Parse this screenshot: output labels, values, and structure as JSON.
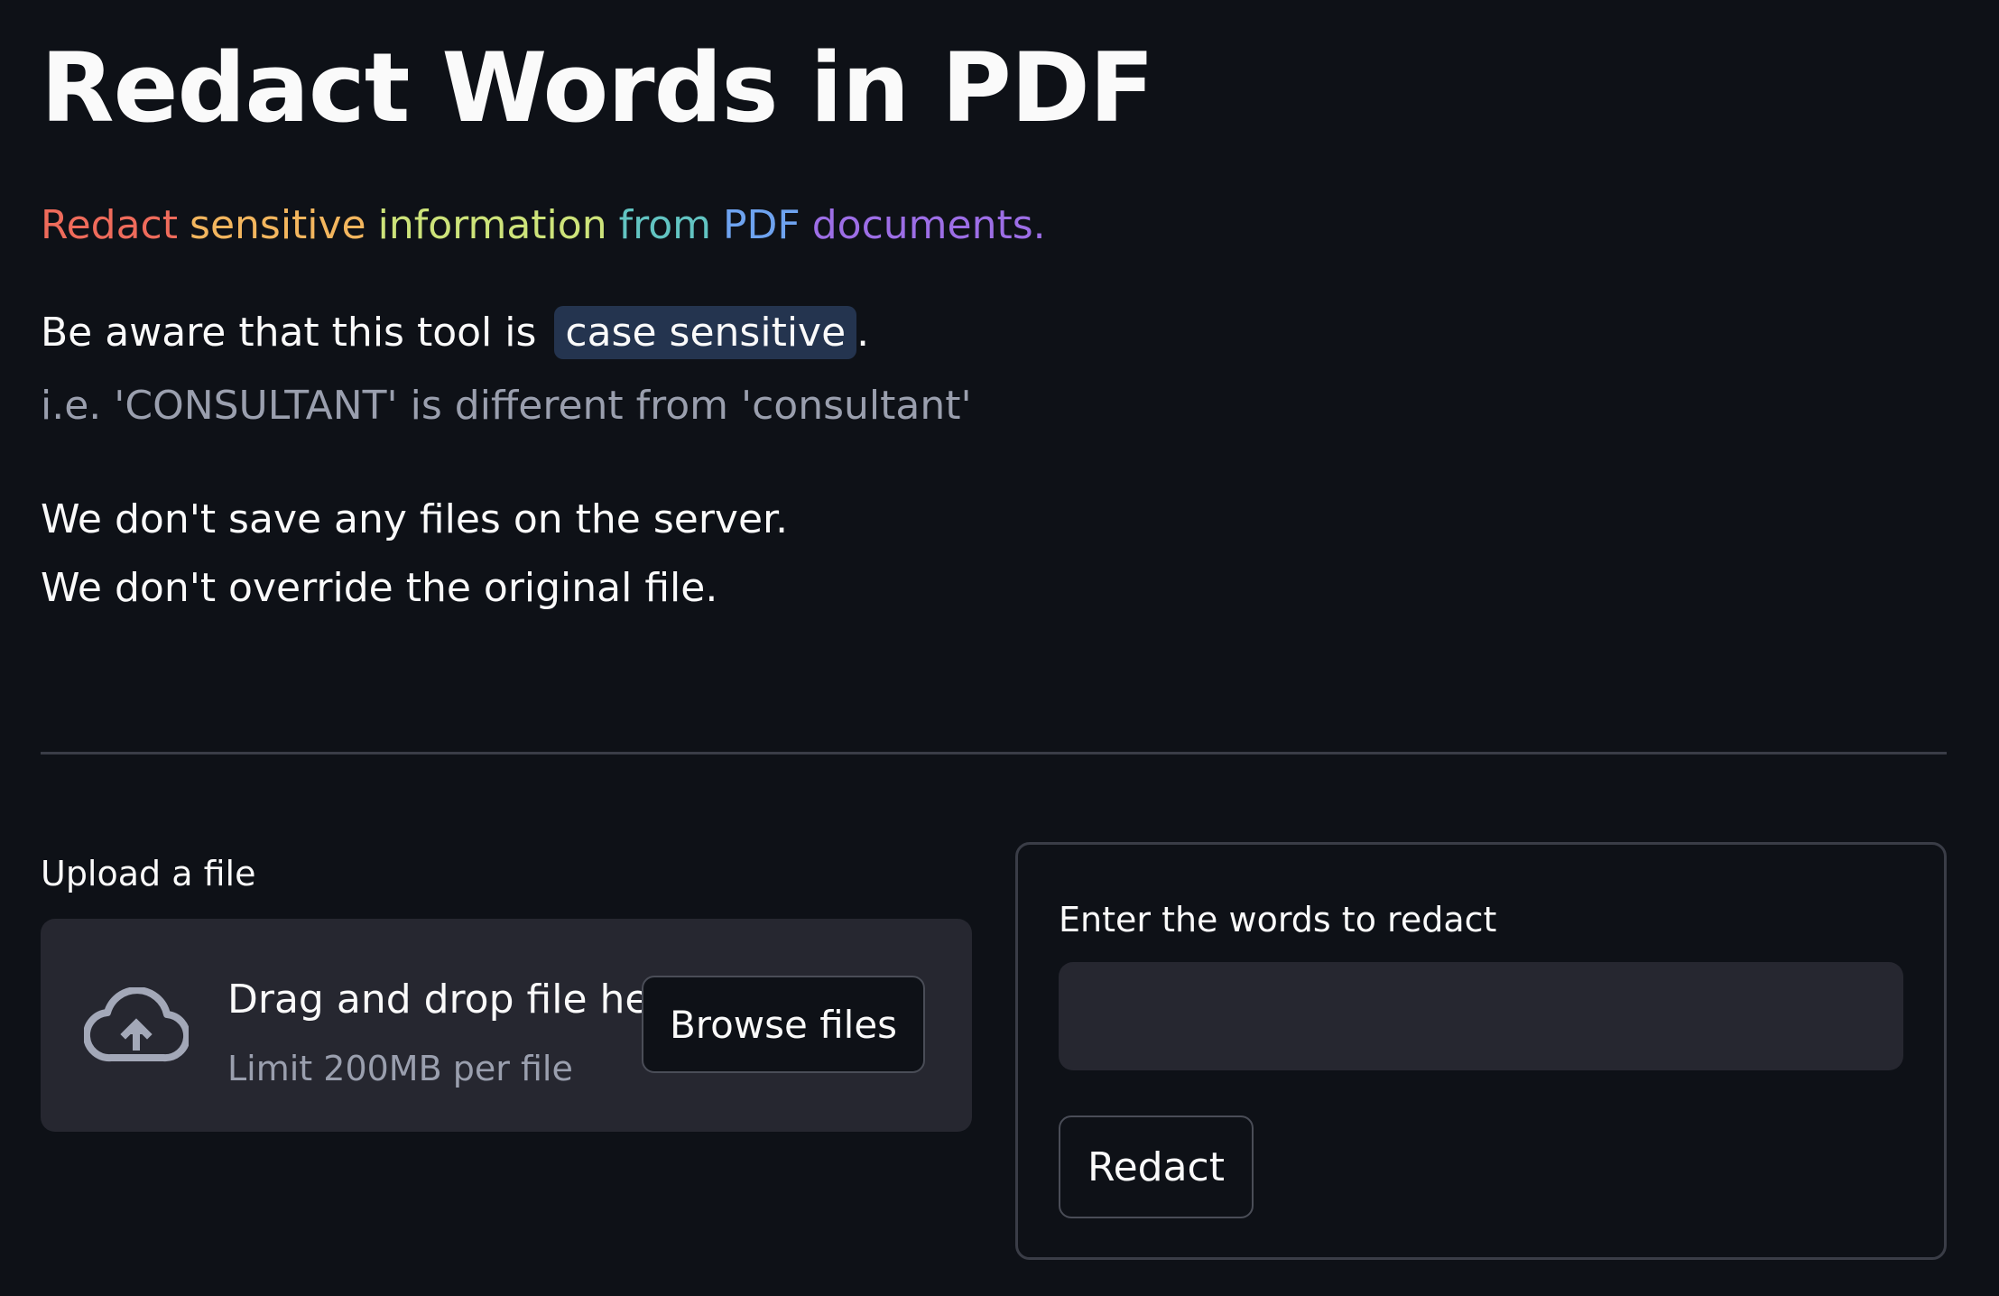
{
  "header": {
    "title": "Redact Words in PDF"
  },
  "subtitle": {
    "words": [
      {
        "text": "Redact",
        "color": "#ef6b5b"
      },
      {
        "text": "sensitive",
        "color": "#f3b65e"
      },
      {
        "text": "information",
        "color": "#cde37a"
      },
      {
        "text": "from",
        "color": "#62c4c2"
      },
      {
        "text": "PDF",
        "color": "#6ea3f0"
      },
      {
        "text": "documents.",
        "color": "#9d6ee6"
      }
    ]
  },
  "notice": {
    "prefix": "Be aware that this tool is",
    "highlight": "case sensitive",
    "suffix": ".",
    "example": "i.e. 'CONSULTANT' is different from 'consultant'"
  },
  "privacy": {
    "line1": "We don't save any files on the server.",
    "line2": "We don't override the original file."
  },
  "uploader": {
    "label": "Upload a file",
    "icon": "cloud-upload-icon",
    "drop_text": "Drag and drop file here",
    "limit_text": "Limit 200MB per file",
    "browse_label": "Browse files"
  },
  "form": {
    "words_label": "Enter the words to redact",
    "words_value": "",
    "submit_label": "Redact"
  },
  "colors": {
    "background": "#0e1117",
    "surface": "#262730",
    "text": "#fafafa",
    "muted": "#9a9fae",
    "code_bg": "#24344f"
  }
}
